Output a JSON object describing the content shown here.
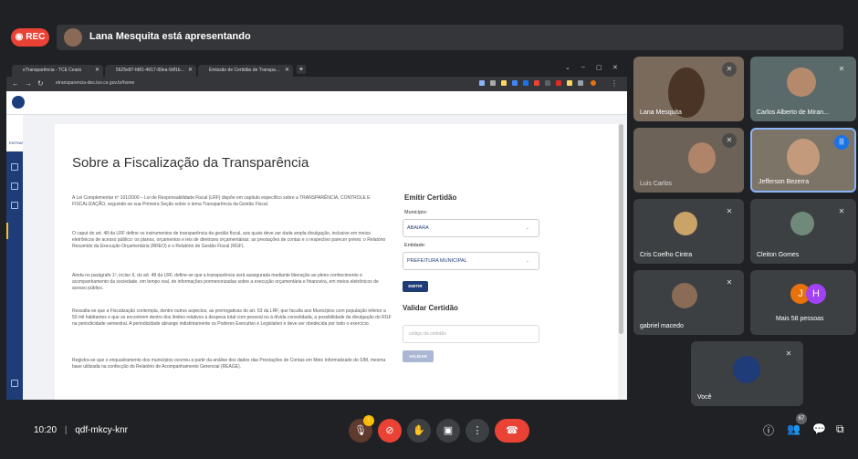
{
  "meet": {
    "rec_label": "REC",
    "presenting_text": "Lana Mesquita está apresentando",
    "meeting_time": "10:20",
    "meeting_code": "qdf-mkcy-knr",
    "separator": "|",
    "people_badge": "67",
    "more_people_label": "Mais 58 pessoas"
  },
  "browser": {
    "tabs": [
      "eTransparência - TCE Ceará",
      "5625e87-fd81-4917-89ea-9df1b…",
      "Emissão de Certidão de Transpa…"
    ],
    "url": "etransparencia-des.tce.ce.gov.br/home"
  },
  "page": {
    "sidebar_label": "ENTRAR",
    "title": "Sobre a Fiscalização da Transparência",
    "paragraphs": [
      "A Lei Complementar nº 101/2000 – Lei de Responsabilidade Fiscal (LRF) dispõe em capítulo específico sobre a TRANSPARÊNCIA, CONTROLE E FISCALIZAÇÃO, seguindo-se sua Primeira Seção sobre o tema Transparência da Gestão Fiscal.",
      "O caput do art. 48 da LRF define os instrumentos de transparência da gestão fiscal, aos quais deve ser dada ampla divulgação, inclusive em meios eletrônicos de acesso público: os planos, orçamentos e leis de diretrizes orçamentárias; as prestações de contas e o respectivo parecer prévio; o Relatório Resumido da Execução Orçamentária (RREO) e o Relatório de Gestão Fiscal (RGF).",
      "Ainda no parágrafo 1º, inciso II, do art. 48 da LRF, define-se que a transparência será assegurada mediante liberação ao pleno conhecimento e acompanhamento da sociedade, em tempo real, de informações pormenorizadas sobre a execução orçamentária e financeira, em meios eletrônicos de acesso público.",
      "Ressalta-se que a Fiscalização contempla, dentre outros aspectos, as prerrogativas do art. 63 da LRF, que faculta aos Municípios com população inferior a 50 mil habitantes e que se encontrem dentro dos limites relativos à despesa total com pessoal ou à dívida consolidada, a possibilidade da divulgação do RGF na periodicidade semestral. A periodicidade abrange indistintamente os Poderes Executivo e Legislativo e deve ser obedecida por todo o exercício.",
      "Registra-se que o enquadramento dos municípios ocorreu a partir da análise dos dados das Prestações de Contas em Meio Informatizado do SIM, mesma base utilizada na confecção do Relatório de Acompanhamento Gerencial (REAGE)."
    ],
    "emitir_heading": "Emitir Certidão",
    "municipio_label": "Município:",
    "municipio_value": "ABAIARA",
    "entidade_label": "Entidade:",
    "entidade_value": "PREFEITURA MUNICIPAL",
    "emitir_button": "EMITIR",
    "validar_heading": "Validar Certidão",
    "codigo_placeholder": "código da certidão",
    "validar_button": "VALIDAR"
  },
  "participants": [
    {
      "name": "Lana Mesquita"
    },
    {
      "name": "Carlos Alberto de Miran..."
    },
    {
      "name": "Luis Carlos"
    },
    {
      "name": "Jefferson Bezerra"
    },
    {
      "name": "Cris Coelho Cintra"
    },
    {
      "name": "Cleiton Gomes"
    },
    {
      "name": "gabriel macedo"
    },
    {
      "name": "Você"
    }
  ],
  "more_people_avatars": [
    "J",
    "H"
  ],
  "colors": {
    "rec": "#ea4335",
    "brand": "#1f3c78",
    "meet_bg": "#202124",
    "speaking": "#1a73e8"
  }
}
